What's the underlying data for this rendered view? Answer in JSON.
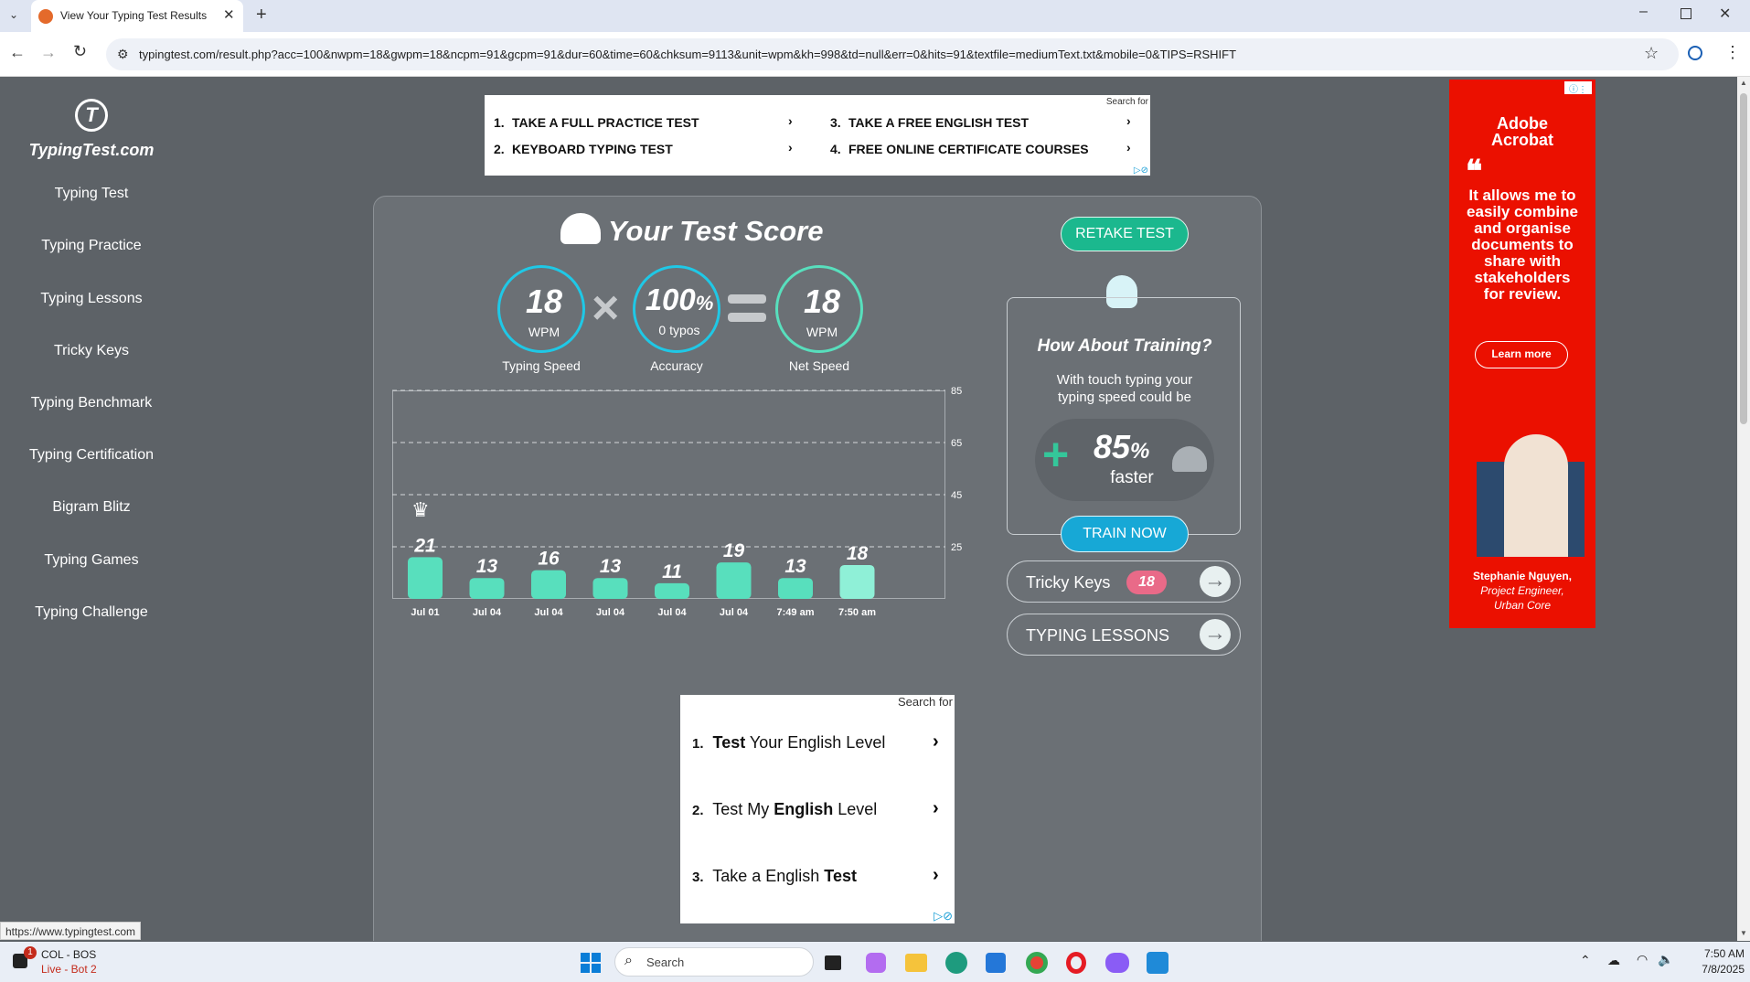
{
  "browser": {
    "tab_title": "View Your Typing Test Results",
    "url": "typingtest.com/result.php?acc=100&nwpm=18&gwpm=18&ncpm=91&gcpm=91&dur=60&time=60&chksum=9113&unit=wpm&kh=998&td=null&err=0&hits=91&textfile=mediumText.txt&mobile=0&TIPS=RSHIFT",
    "status_url": "https://www.typingtest.com"
  },
  "sidebar": {
    "logo_text": "TypingTest.com",
    "items": [
      {
        "label": "Typing Test"
      },
      {
        "label": "Typing Practice"
      },
      {
        "label": "Typing Lessons"
      },
      {
        "label": "Tricky Keys"
      },
      {
        "label": "Typing Benchmark"
      },
      {
        "label": "Typing Certification"
      },
      {
        "label": "Bigram Blitz"
      },
      {
        "label": "Typing Games"
      },
      {
        "label": "Typing Challenge"
      }
    ]
  },
  "top_ad": {
    "search_for": "Search for",
    "items": [
      {
        "num": "1.",
        "text": "TAKE A FULL PRACTICE TEST"
      },
      {
        "num": "2.",
        "text": "KEYBOARD TYPING TEST"
      },
      {
        "num": "3.",
        "text": "TAKE A FREE ENGLISH TEST"
      },
      {
        "num": "4.",
        "text": "FREE ONLINE CERTIFICATE COURSES"
      }
    ]
  },
  "score": {
    "title": "Your Test Score",
    "retake": "RETAKE TEST",
    "typing_speed": {
      "value": "18",
      "unit": "WPM",
      "label": "Typing Speed"
    },
    "accuracy": {
      "value": "100",
      "pct": "%",
      "sub": "0 typos",
      "label": "Accuracy"
    },
    "net_speed": {
      "value": "18",
      "unit": "WPM",
      "label": "Net Speed"
    }
  },
  "chart_data": {
    "type": "bar",
    "categories": [
      "Jul 01",
      "Jul 04",
      "Jul 04",
      "Jul 04",
      "Jul 04",
      "Jul 04",
      "7:49 am",
      "7:50 am"
    ],
    "values": [
      21,
      13,
      16,
      13,
      11,
      19,
      13,
      18
    ],
    "yticks": [
      "85",
      "65",
      "45",
      "25"
    ],
    "ylim": [
      5,
      85
    ],
    "grid": true
  },
  "training": {
    "title": "How About Training?",
    "text": "With touch typing your typing speed could be",
    "percent": "85",
    "pct": "%",
    "faster": "faster",
    "button": "TRAIN NOW"
  },
  "tricky_keys": {
    "label": "Tricky Keys",
    "count": "18"
  },
  "typing_lessons": {
    "label": "TYPING LESSONS"
  },
  "bottom_ad": {
    "search_for": "Search for",
    "items": [
      {
        "num": "1.",
        "pre": "",
        "bold": "Test",
        "post": " Your English Level"
      },
      {
        "num": "2.",
        "pre": "Test My ",
        "bold": "English",
        "post": " Level"
      },
      {
        "num": "3.",
        "pre": "Take a English ",
        "bold": "Test",
        "post": ""
      }
    ]
  },
  "side_ad": {
    "brand_line1": "Adobe",
    "brand_line2": "Acrobat",
    "quote": "It allows me to easily combine and organise documents to share with stakeholders for review.",
    "cta": "Learn more",
    "person_name": "Stephanie Nguyen,",
    "person_title1": "Project Engineer,",
    "person_title2": "Urban Core"
  },
  "taskbar": {
    "weather_line1": "COL - BOS",
    "weather_line2": "Live - Bot 2",
    "badge": "1",
    "search": "Search",
    "time": "7:50 AM",
    "date": "7/8/2025"
  },
  "colors": {
    "accent": "#58dfbd",
    "circle_border": "#1fc8e6",
    "train_btn": "#17a8d6",
    "retake_btn": "#1bb88e",
    "ad_red": "#eb1000"
  }
}
